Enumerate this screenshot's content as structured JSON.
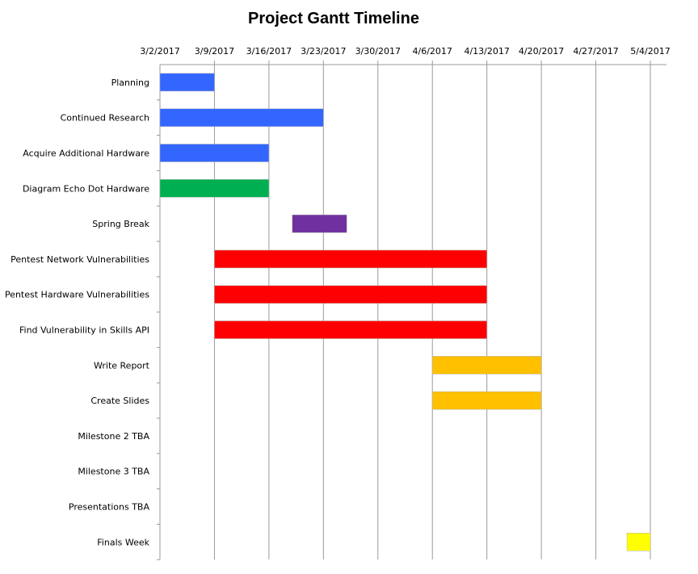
{
  "chart_data": {
    "type": "gantt",
    "title": "Project Gantt Timeline",
    "x_ticks": [
      "3/2/2017",
      "3/9/2017",
      "3/16/2017",
      "3/23/2017",
      "3/30/2017",
      "4/6/2017",
      "4/13/2017",
      "4/20/2017",
      "4/27/2017",
      "5/4/2017"
    ],
    "xlim": [
      "2017-03-02",
      "2017-05-04"
    ],
    "grid": true,
    "tasks": [
      {
        "name": "Planning",
        "start": "2017-03-02",
        "end": "2017-03-09",
        "color": "#3366ff"
      },
      {
        "name": "Continued Research",
        "start": "2017-03-02",
        "end": "2017-03-23",
        "color": "#3366ff"
      },
      {
        "name": "Acquire Additional Hardware",
        "start": "2017-03-02",
        "end": "2017-03-16",
        "color": "#3366ff"
      },
      {
        "name": "Diagram Echo Dot Hardware",
        "start": "2017-03-02",
        "end": "2017-03-16",
        "color": "#00b050"
      },
      {
        "name": "Spring Break",
        "start": "2017-03-19",
        "end": "2017-03-26",
        "color": "#7030a0"
      },
      {
        "name": "Pentest Network Vulnerabilities",
        "start": "2017-03-09",
        "end": "2017-04-13",
        "color": "#ff0000"
      },
      {
        "name": "Pentest Hardware Vulnerabilities",
        "start": "2017-03-09",
        "end": "2017-04-13",
        "color": "#ff0000"
      },
      {
        "name": "Find Vulnerability in Skills API",
        "start": "2017-03-09",
        "end": "2017-04-13",
        "color": "#ff0000"
      },
      {
        "name": "Write Report",
        "start": "2017-04-06",
        "end": "2017-04-20",
        "color": "#ffc000"
      },
      {
        "name": "Create Slides",
        "start": "2017-04-06",
        "end": "2017-04-20",
        "color": "#ffc000"
      },
      {
        "name": "Milestone 2 TBA",
        "start": null,
        "end": null,
        "color": null
      },
      {
        "name": "Milestone 3 TBA",
        "start": null,
        "end": null,
        "color": null
      },
      {
        "name": "Presentations TBA",
        "start": null,
        "end": null,
        "color": null
      },
      {
        "name": "Finals Week",
        "start": "2017-05-01",
        "end": "2017-05-04",
        "color": "#ffff00"
      }
    ]
  }
}
